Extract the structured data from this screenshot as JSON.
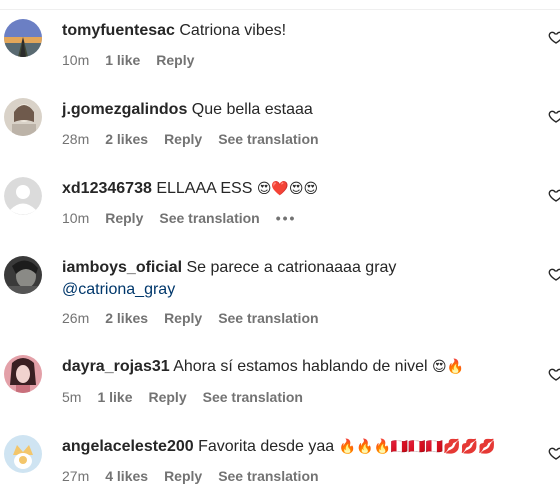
{
  "comments": [
    {
      "username": "tomyfuentesac",
      "text": "Catriona vibes!",
      "time": "10m",
      "likes": "1 like",
      "reply": "Reply",
      "avatar": {
        "desc": "road-sunset-avatar",
        "colors": [
          "#6b7fc4",
          "#e2a65a",
          "#2b2b2b"
        ]
      }
    },
    {
      "username": "j.gomezgalindos",
      "text": "Que bella estaaa",
      "time": "28m",
      "likes": "2 likes",
      "reply": "Reply",
      "translate": "See translation",
      "avatar": {
        "desc": "person-photo-avatar",
        "colors": [
          "#d9d2c8",
          "#6f5a4c",
          "#ede6dc"
        ]
      }
    },
    {
      "username": "xd12346738",
      "text": "ELLAAA ESS",
      "emojis": "😍❤️😍😍",
      "time": "10m",
      "reply": "Reply",
      "translate": "See translation",
      "more": "•••",
      "avatar": {
        "desc": "default-profile-avatar",
        "colors": [
          "#dbdbdb",
          "#ffffff"
        ]
      }
    },
    {
      "username": "iamboys_oficial",
      "text": "Se parece a catrionaaaa gray",
      "mention": "@catriona_gray",
      "time": "26m",
      "likes": "2 likes",
      "reply": "Reply",
      "translate": "See translation",
      "avatar": {
        "desc": "dark-photo-avatar",
        "colors": [
          "#3a3a3a",
          "#8a8a86",
          "#1c1c1c"
        ]
      }
    },
    {
      "username": "dayra_rojas31",
      "text": "Ahora sí estamos hablando de nivel",
      "emojis": "😍🔥",
      "time": "5m",
      "likes": "1 like",
      "reply": "Reply",
      "translate": "See translation",
      "avatar": {
        "desc": "portrait-red-avatar",
        "colors": [
          "#e3a0a8",
          "#3a1f22",
          "#f1d3cf"
        ]
      }
    },
    {
      "username": "angelaceleste200",
      "text": "Favorita desde yaa",
      "emojis": "🔥🔥🔥🇵🇪🇵🇪🇵🇪💋💋💋",
      "time": "27m",
      "likes": "4 likes",
      "reply": "Reply",
      "translate": "See translation",
      "avatar": {
        "desc": "crown-illustration-avatar",
        "colors": [
          "#cfe4f2",
          "#f3c66b",
          "#ffffff"
        ]
      }
    }
  ],
  "icons": {
    "like": "heart-outline-icon",
    "more": "more-options-icon"
  },
  "colors": {
    "primary_text": "#262626",
    "secondary_text": "#737373",
    "mention": "#00376b",
    "divider": "#efefef"
  }
}
